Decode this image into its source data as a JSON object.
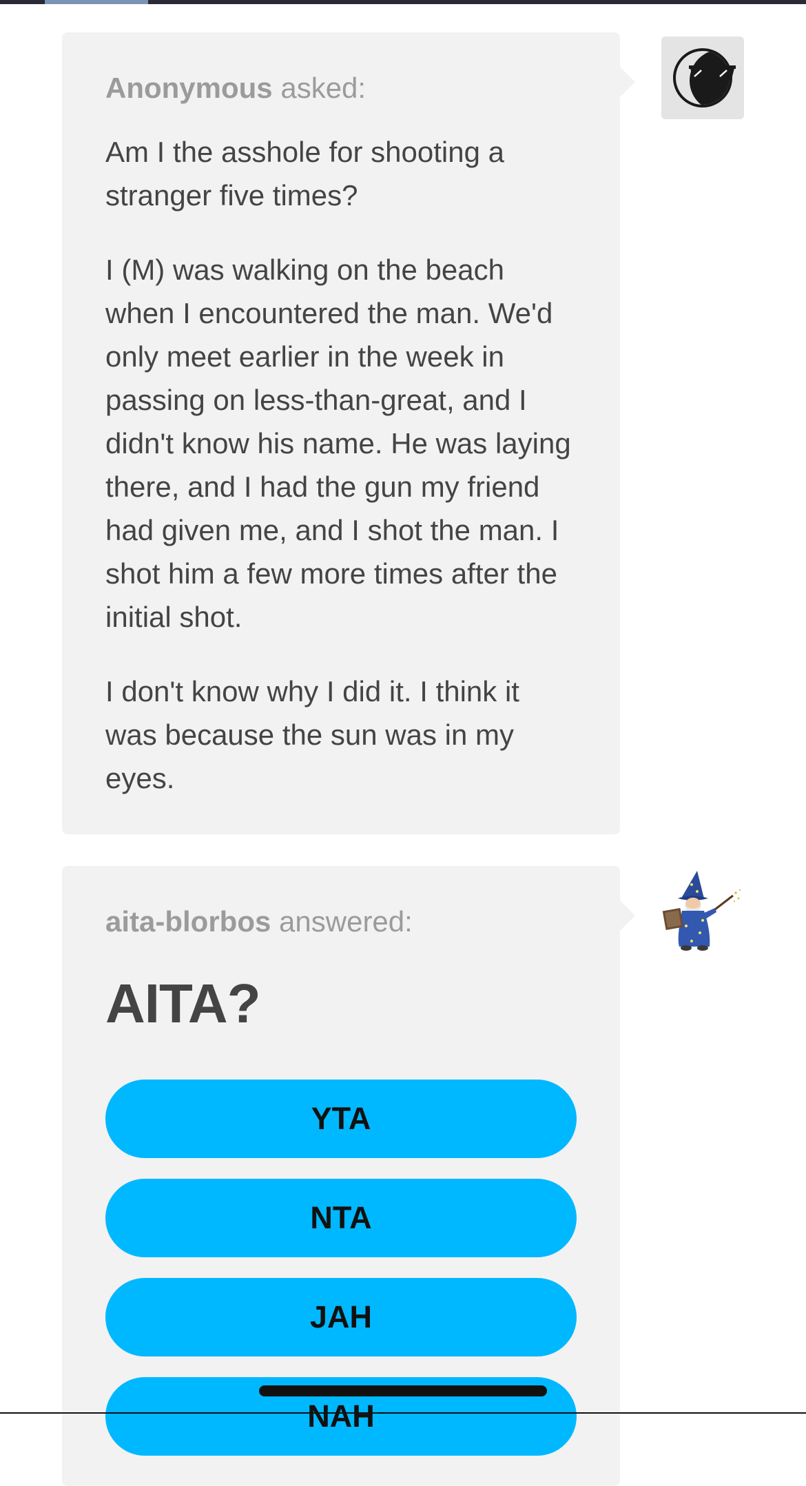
{
  "ask": {
    "asker_name": "Anonymous",
    "asked_label": "asked:",
    "question": "Am I the asshole for shooting a stranger five times?",
    "paragraph_1": "I (M) was walking on the beach when I encountered the man. We'd only meet earlier in the week in passing on less-than-great, and I didn't know his name. He was laying there, and I had the gun my friend had given me, and I shot the man. I shot him a few more times after the initial shot.",
    "paragraph_2": "I don't know why I did it. I think it was because the sun was in my eyes."
  },
  "answer": {
    "answerer_name": "aita-blorbos",
    "answered_label": "answered:",
    "poll_title": "AITA?",
    "options": [
      "YTA",
      "NTA",
      "JAH",
      "NAH"
    ]
  },
  "avatars": {
    "asker_icon": "sunglasses-moon-icon",
    "answerer_icon": "wizard-icon"
  },
  "colors": {
    "bubble_bg": "#f2f2f2",
    "poll_button": "#00b8ff",
    "text": "#444444",
    "muted_text": "#9b9b9b"
  }
}
